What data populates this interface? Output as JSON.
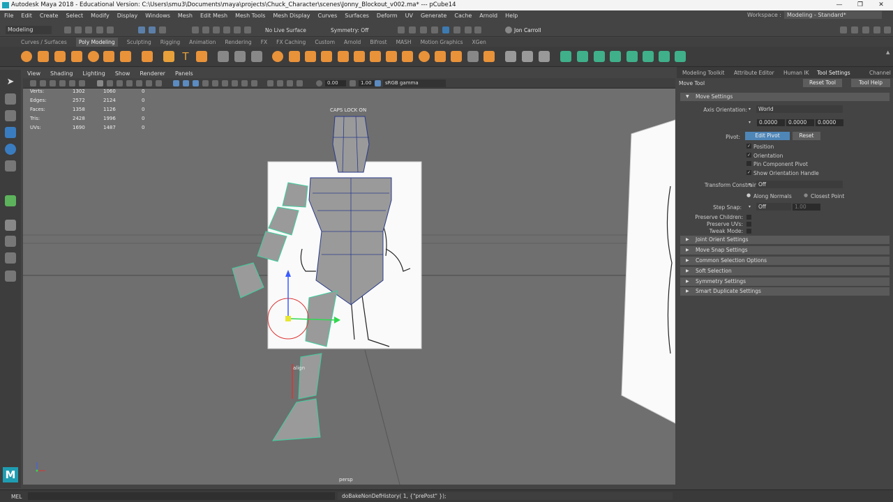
{
  "window": {
    "title": "Autodesk Maya 2018 - Educational Version: C:\\Users\\smu3\\Documents\\maya\\projects\\Chuck_Character\\scenes\\Jonny_Blockout_v002.ma*   ---   pCube14",
    "minimize": "—",
    "maximize": "❐",
    "close": "✕"
  },
  "menus": [
    "File",
    "Edit",
    "Create",
    "Select",
    "Modify",
    "Display",
    "Windows",
    "Mesh",
    "Edit Mesh",
    "Mesh Tools",
    "Mesh Display",
    "Curves",
    "Surfaces",
    "Deform",
    "UV",
    "Generate",
    "Cache",
    "Arnold",
    "Help"
  ],
  "workspace": {
    "label": "Workspace :",
    "value": "Modeling - Standard*"
  },
  "statusline": {
    "mode": "Modeling",
    "live_surface": "No Live Surface",
    "symmetry": "Symmetry: Off",
    "user": "Jon Carroll"
  },
  "shelf_tabs": [
    "Curves / Surfaces",
    "Poly Modeling",
    "Sculpting",
    "Rigging",
    "Animation",
    "Rendering",
    "FX",
    "FX Caching",
    "Custom",
    "Arnold",
    "Bifrost",
    "MASH",
    "Motion Graphics",
    "XGen"
  ],
  "shelf_active_tab": "Poly Modeling",
  "panel_menu": [
    "View",
    "Shading",
    "Lighting",
    "Show",
    "Renderer",
    "Panels"
  ],
  "panel_toolbar": {
    "field1": "0.00",
    "field2": "1.00",
    "color_space": "sRGB gamma"
  },
  "hud": {
    "rows": [
      {
        "label": "Verts:",
        "a": "1302",
        "b": "1060",
        "c": "0"
      },
      {
        "label": "Edges:",
        "a": "2572",
        "b": "2124",
        "c": "0"
      },
      {
        "label": "Faces:",
        "a": "1358",
        "b": "1126",
        "c": "0"
      },
      {
        "label": "Tris:",
        "a": "2428",
        "b": "1996",
        "c": "0"
      },
      {
        "label": "UVs:",
        "a": "1690",
        "b": "1487",
        "c": "0"
      }
    ],
    "caps_lock": "CAPS LOCK ON",
    "camera": "persp",
    "cursor_label": "align"
  },
  "right_panel": {
    "tabs": [
      "Modeling Toolkit",
      "Attribute Editor",
      "Human IK",
      "Tool Settings",
      "Channel"
    ],
    "active_tab": "Tool Settings",
    "tool_name": "Move Tool",
    "reset_tool": "Reset Tool",
    "tool_help": "Tool Help",
    "move_settings": "Move Settings",
    "axis_orientation_label": "Axis Orientation:",
    "axis_orientation_value": "World",
    "axis_values": [
      "0.0000",
      "0.0000",
      "0.0000"
    ],
    "pivot_label": "Pivot:",
    "edit_pivot": "Edit Pivot",
    "reset": "Reset",
    "pivot_options": [
      {
        "label": "Position",
        "checked": "✓"
      },
      {
        "label": "Orientation",
        "checked": "✓"
      },
      {
        "label": "Pin Component Pivot",
        "checked": ""
      },
      {
        "label": "Show Orientation Handle",
        "checked": "✓"
      }
    ],
    "transform_constraint_label": "Transform Constraint:",
    "transform_constraint_value": "Off",
    "along_normals": "Along Normals",
    "closest_point": "Closest Point",
    "step_snap_label": "Step Snap:",
    "step_snap_value": "Off",
    "step_snap_amount": "1.00",
    "preserve_children": "Preserve Children:",
    "preserve_uvs": "Preserve UVs:",
    "tweak_mode": "Tweak Mode:",
    "collapsed_sections": [
      "Joint Orient Settings",
      "Move Snap Settings",
      "Common Selection Options",
      "Soft Selection",
      "Symmetry Settings",
      "Smart Duplicate Settings"
    ]
  },
  "helpline": {
    "lang": "MEL",
    "command": "doBakeNonDefHistory( 1, {\"prePost\" });"
  }
}
